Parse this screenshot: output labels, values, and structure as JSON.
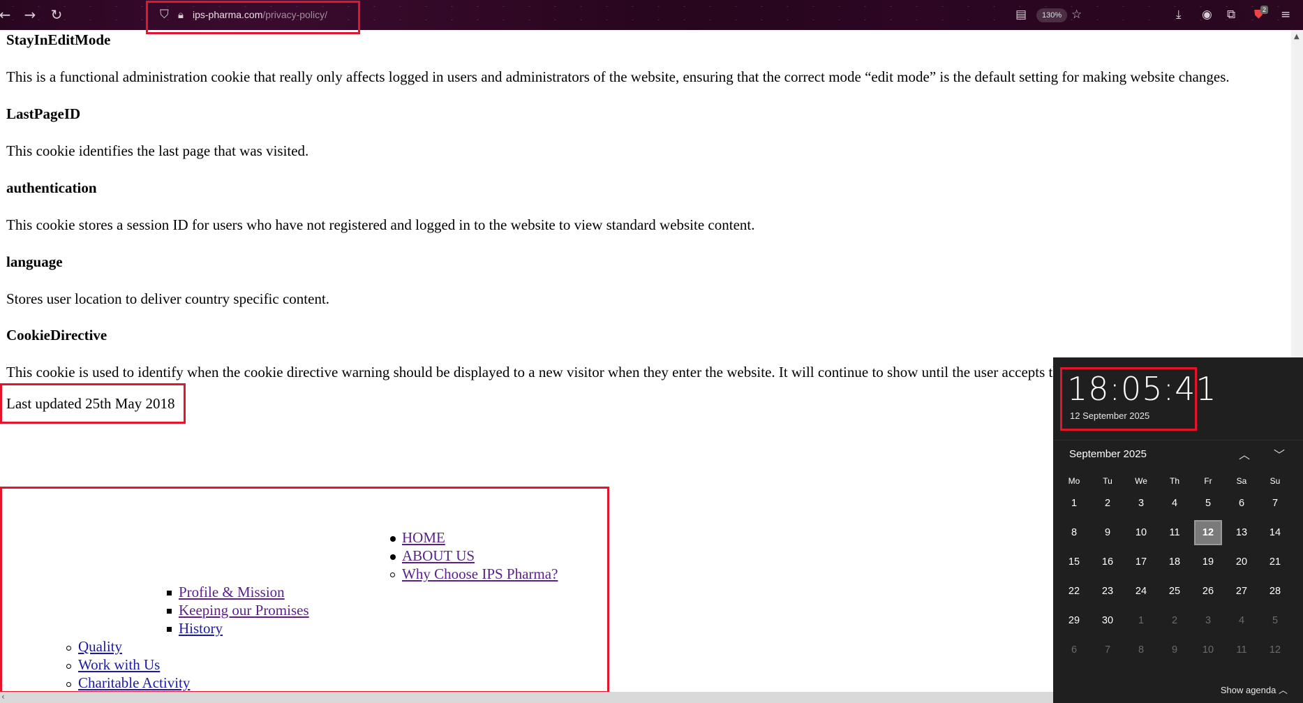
{
  "browser": {
    "url_host": "ips-pharma.com",
    "url_path": "/privacy-policy/",
    "zoom": "130%",
    "downloads_badge": "2"
  },
  "policy": {
    "items": [
      {
        "heading": "StayInEditMode",
        "text": "This is a functional administration cookie that really only affects logged in users and administrators of the website, ensuring that the correct mode “edit mode” is the default setting for making website changes."
      },
      {
        "heading": "LastPageID",
        "text": "This cookie identifies the last page that was visited."
      },
      {
        "heading": "authentication",
        "text": "This cookie stores a session ID for users who have not registered and logged in to the website to view standard website content."
      },
      {
        "heading": "language",
        "text": "Stores user location to deliver country specific content."
      },
      {
        "heading": "CookieDirective",
        "text": "This cookie is used to identify when the cookie directive warning should be displayed to a new visitor when they enter the website. It will continue to show until the user accepts th"
      }
    ],
    "last_updated": "Last updated 25th May 2018"
  },
  "footer_nav": {
    "top_level": [
      "HOME",
      "ABOUT US"
    ],
    "about_sub": [
      "Why Choose IPS Pharma?"
    ],
    "square_items": [
      "Profile & Mission",
      "Keeping our Promises",
      "History"
    ],
    "circle_items": [
      "Quality",
      "Work with Us",
      "Charitable Activity"
    ]
  },
  "clock": {
    "time": "18:05:41",
    "date": "12 September 2025",
    "month_label": "September 2025",
    "weekdays": [
      "Mo",
      "Tu",
      "We",
      "Th",
      "Fr",
      "Sa",
      "Su"
    ],
    "weeks": [
      [
        "1",
        "2",
        "3",
        "4",
        "5",
        "6",
        "7"
      ],
      [
        "8",
        "9",
        "10",
        "11",
        "12",
        "13",
        "14"
      ],
      [
        "15",
        "16",
        "17",
        "18",
        "19",
        "20",
        "21"
      ],
      [
        "22",
        "23",
        "24",
        "25",
        "26",
        "27",
        "28"
      ],
      [
        "29",
        "30",
        "1",
        "2",
        "3",
        "4",
        "5"
      ],
      [
        "6",
        "7",
        "8",
        "9",
        "10",
        "11",
        "12"
      ]
    ],
    "selected_day": "12",
    "show_agenda": "Show agenda"
  }
}
